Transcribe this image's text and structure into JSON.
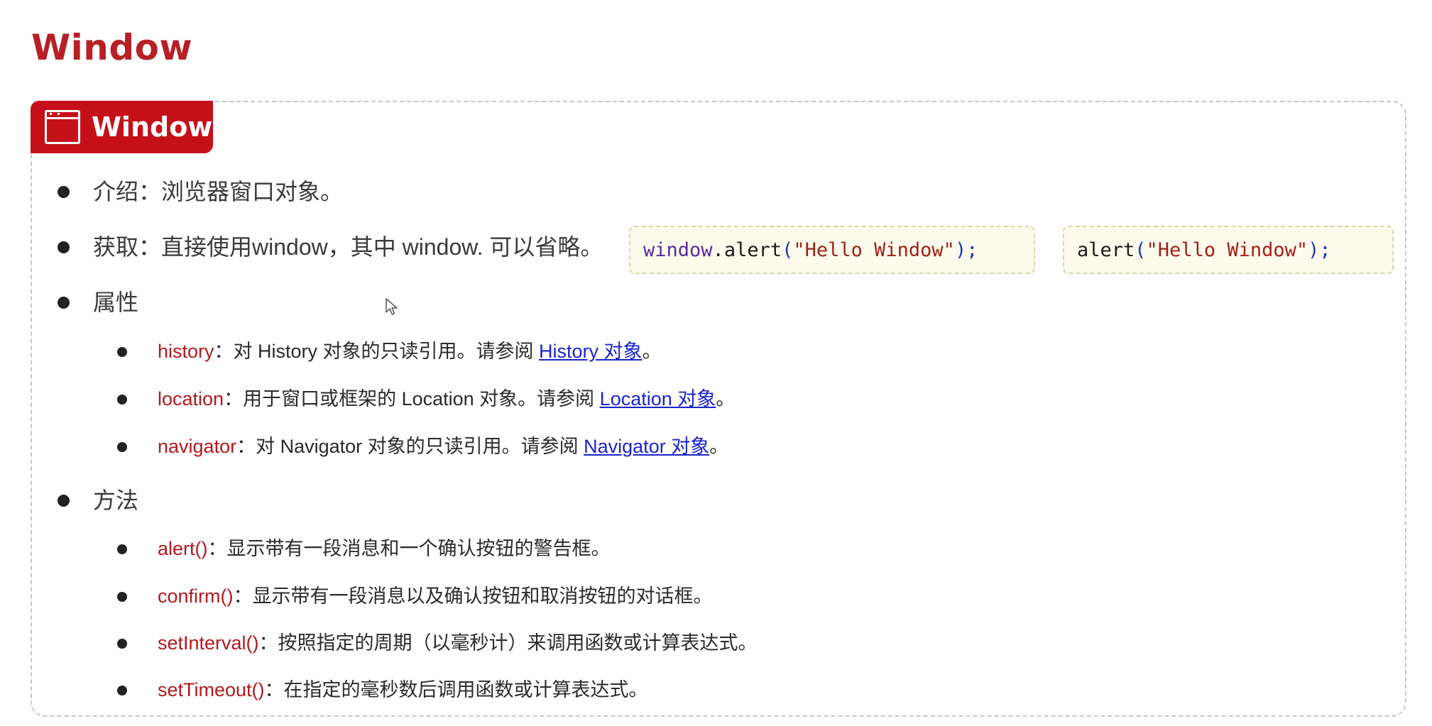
{
  "page": {
    "title": "Window"
  },
  "card": {
    "tab_label": "Window",
    "tab_icon": "browser-window-icon",
    "accent_color": "#c5101a"
  },
  "intro": {
    "label": "介绍",
    "sep": "：",
    "text": "浏览器窗口对象。"
  },
  "access": {
    "label": "获取",
    "sep": "：",
    "text": "直接使用window，其中 window. 可以省略。",
    "code_examples": [
      {
        "obj": "window",
        "dot": ".",
        "method": "alert",
        "open": "(",
        "arg": "\"Hello Window\"",
        "close": ");"
      },
      {
        "method": "alert",
        "open": "(",
        "arg": "\"Hello Window\"",
        "close": ");"
      }
    ]
  },
  "properties": {
    "label": "属性",
    "items": [
      {
        "name": "history",
        "sep": "：",
        "desc": "对 History 对象的只读引用。请参阅 ",
        "link": "History 对象",
        "end": "。"
      },
      {
        "name": "location",
        "sep": "：",
        "desc": "用于窗口或框架的 Location 对象。请参阅 ",
        "link": "Location 对象",
        "end": "。"
      },
      {
        "name": "navigator",
        "sep": "：",
        "desc": "对 Navigator 对象的只读引用。请参阅 ",
        "link": "Navigator 对象",
        "end": "。"
      }
    ]
  },
  "methods": {
    "label": "方法",
    "items": [
      {
        "name": "alert()",
        "sep": "：",
        "desc": "显示带有一段消息和一个确认按钮的警告框。"
      },
      {
        "name": "confirm()",
        "sep": "：",
        "desc": "显示带有一段消息以及确认按钮和取消按钮的对话框。"
      },
      {
        "name": "setInterval()",
        "sep": "：",
        "desc": "按照指定的周期（以毫秒计）来调用函数或计算表达式。"
      },
      {
        "name": "setTimeout()",
        "sep": "：",
        "desc": "在指定的毫秒数后调用函数或计算表达式。"
      }
    ]
  }
}
